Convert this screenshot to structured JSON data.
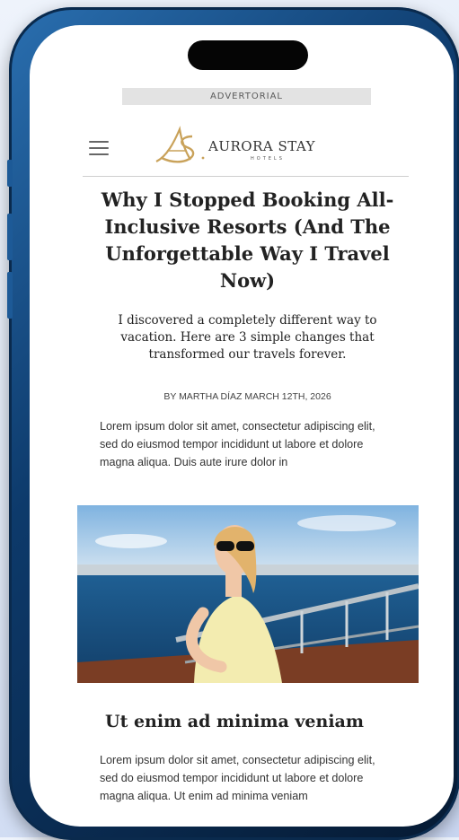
{
  "ad_label": "ADVERTORIAL",
  "brand": {
    "name": "AURORA STAY",
    "subtitle": "HOTELS",
    "logo_letters": "AS",
    "gold": "#c9a25a"
  },
  "article": {
    "headline": "Why I Stopped Booking All-Inclusive Resorts (And The Unforgettable Way I Travel Now)",
    "subhead": "I discovered a completely different way to vacation. Here are 3 simple changes that transformed our travels forever.",
    "byline": "BY MARTHA DÍAZ MARCH 12TH, 2026",
    "intro": "Lorem ipsum dolor sit amet, consectetur adipiscing elit, sed do eiusmod tempor incididunt ut labore et dolore magna aliqua. Duis aute irure dolor in",
    "section_heading": "Ut enim ad minima veniam",
    "section_text": "Lorem ipsum dolor sit amet, consectetur adipiscing elit, sed do eiusmod tempor incididunt ut labore et dolore magna aliqua. Ut enim ad minima veniam"
  },
  "icons": {
    "menu": "hamburger-menu-icon",
    "logo": "aurora-stay-logo"
  },
  "colors": {
    "phone_frame": "#0d3a6b",
    "text": "#222222",
    "divider": "#cfcfcf"
  }
}
